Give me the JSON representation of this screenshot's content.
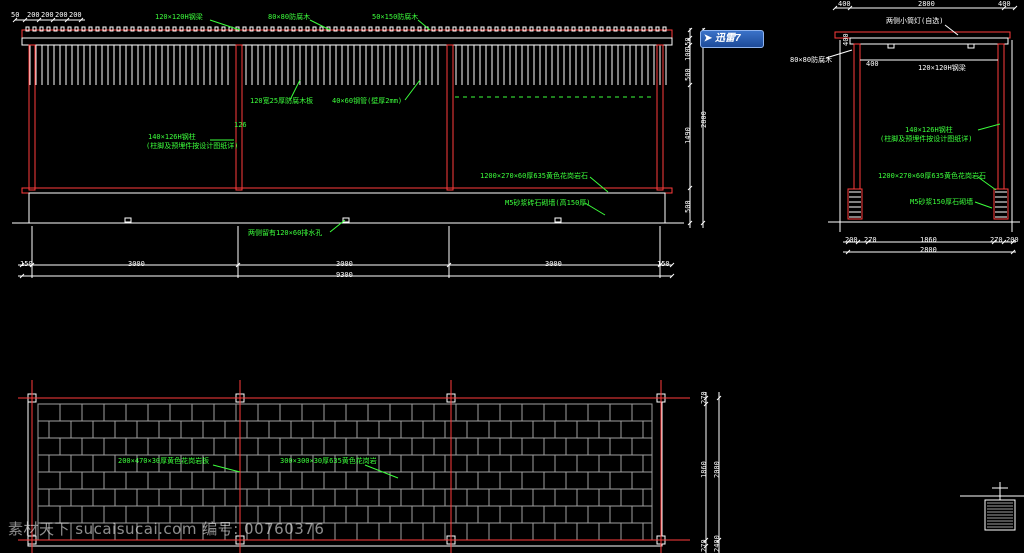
{
  "colors": {
    "background": "#000000",
    "steel": "#ff3b3b",
    "annotation": "#3cff3c",
    "dimension": "#ffffff",
    "paving": "#a0a0a0",
    "badge": "#2a5fb8"
  },
  "elevation": {
    "top_dims": [
      "50",
      "200",
      "200",
      "200",
      "200"
    ],
    "labels": {
      "h_steel": "120×120H钢梁",
      "wood_80": "80×80防腐木",
      "wood_50": "50×150防腐木",
      "wood_board": "120宽25厚防腐木板",
      "steel_pipe": "40×60钢管(壁厚2mm)",
      "h_column_1": "140×126H钢柱",
      "h_column_2": "(柱脚及预埋件按设计图纸详)",
      "column_tag": "126",
      "seat": "1200×270×60厚635黄色花岗岩石",
      "wall": "M5砂浆砖石砌墙(高150厚)",
      "drain": "两侧留有120×60排水孔"
    },
    "right_dims": [
      "150",
      "100",
      "500",
      "1490",
      "2800",
      "500"
    ],
    "bottom_dims": {
      "left": "150",
      "bays": [
        "3000",
        "3000",
        "3000"
      ],
      "right": "150",
      "total": "9300"
    }
  },
  "side": {
    "top_dims": {
      "a": "400",
      "b": "2800",
      "c": "400"
    },
    "labels": {
      "lamp": "两侧小筒灯(自选)",
      "wood_80": "80×80防腐木",
      "dim_400a": "400",
      "dim_400b": "400",
      "h_steel": "120×120H钢梁",
      "h_column_1": "140×126H钢柱",
      "h_column_2": "(柱脚及预埋件按设计图纸详)",
      "seat": "1200×270×60厚635黄色花岗岩石",
      "wall": "M5砂浆150厚石砌墙"
    },
    "bottom_dims": {
      "a": "200",
      "b": "270",
      "c": "1860",
      "d": "270",
      "e": "200",
      "total": "2800"
    }
  },
  "plan": {
    "labels": {
      "paving_a": "200×470×30厚黄色花岗岩板",
      "paving_b": "300×300×30厚635黄色花岗岩"
    },
    "right_dims": [
      "270",
      "1860",
      "2000",
      "270",
      "2400"
    ]
  },
  "badge": {
    "label": "迅雷7",
    "icon": "bird-icon"
  },
  "watermark": "素材天下 sucaisucai.com  编号: 00760376"
}
